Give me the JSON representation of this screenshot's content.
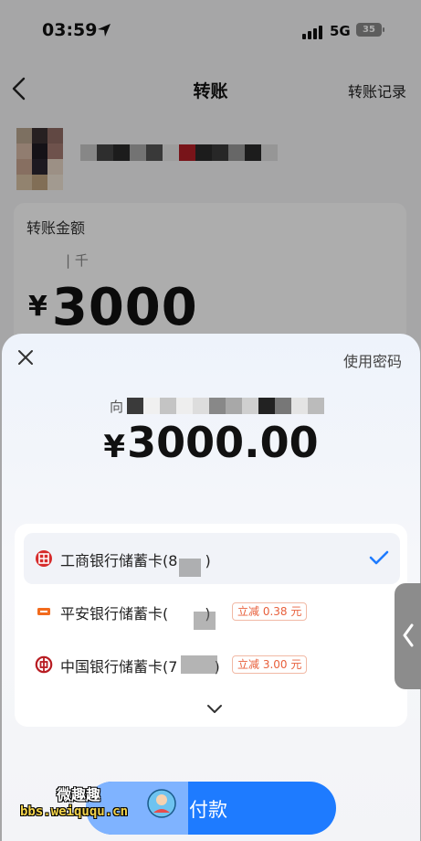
{
  "status_bar": {
    "time": "03:59",
    "network": "5G",
    "battery": "35"
  },
  "nav": {
    "title": "转账",
    "records": "转账记录"
  },
  "transfer": {
    "amount_label": "转账金额",
    "amount_unit": "| 千",
    "currency": "¥",
    "amount": "3000"
  },
  "sheet": {
    "use_password": "使用密码",
    "payee_prefix": "向",
    "currency": "¥",
    "amount": "3000.00",
    "cards": [
      {
        "name": "工商银行储蓄卡(8",
        "tail": ")",
        "bank_icon": "icbc-logo-icon",
        "selected": true,
        "promo": ""
      },
      {
        "name": "平安银行储蓄卡(",
        "tail": ")",
        "bank_icon": "pingan-logo-icon",
        "selected": false,
        "promo": "立减 0.38 元"
      },
      {
        "name": "中国银行储蓄卡(7",
        "tail": ")",
        "bank_icon": "boc-logo-icon",
        "selected": false,
        "promo": "立减 3.00 元"
      }
    ],
    "pay_button": "付款"
  },
  "watermark": {
    "title": "微趣趣",
    "url": "bbs.weiququ.cn"
  },
  "colors": {
    "accent": "#1e7bff",
    "promo": "#e8603c",
    "icbc": "#d62b2b",
    "boc": "#b81c22",
    "pingan": "#f26b1d"
  }
}
